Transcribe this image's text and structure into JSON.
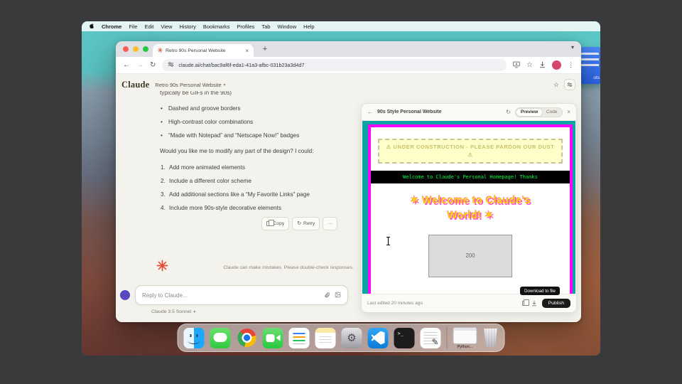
{
  "colors": {
    "claude_accent": "#d97757",
    "starburst_red": "#e2502f",
    "retro_magenta": "#ff00ff",
    "retro_teal": "#0aa3a6",
    "marquee_green": "#00ff41",
    "heading_gold": "#ffd400",
    "heading_pink": "#ff4fc0",
    "publish_dark": "#1b1a18",
    "browser_avatar_pink": "#d64570",
    "composer_avatar_purple": "#5849c0"
  },
  "icons": {
    "back": "←",
    "forward": "→",
    "reload": "↻",
    "new_tab": "+",
    "tab_close": "×",
    "tab_search_chevron": "▾",
    "star": "☆",
    "kebab_menu": "⋮",
    "chevron_down": "▾",
    "artifact_back": "←",
    "artifact_refresh": "↻",
    "artifact_close": "×",
    "retry": "↻",
    "more_options": "···",
    "gear": "⚙",
    "pencil": "✎",
    "terminal_prompt": ">_"
  },
  "menubar": {
    "app_name": "Chrome",
    "items": [
      "File",
      "Edit",
      "View",
      "History",
      "Bookmarks",
      "Profiles",
      "Tab",
      "Window",
      "Help"
    ]
  },
  "desktop": {
    "widget_label": "ots"
  },
  "browser": {
    "tab_title": "Retro 90s Personal Website",
    "url": "claude.ai/chat/bac9af6f-eda1-41a3-afbc-031b23a3d4d7"
  },
  "claude": {
    "logo_text": "Claude",
    "chat_title": "Retro 90s Personal Website",
    "message": {
      "clipped_line": "typically be GIFs in the 90s)",
      "bullets": [
        "Dashed and groove borders",
        "High-contrast color combinations",
        "“Made with Notepad” and “Netscape Now!” badges"
      ],
      "question": "Would you like me to modify any part of the design? I could:",
      "numbered_items": [
        "Add more animated elements",
        "Include a different color scheme",
        "Add additional sections like a “My Favorite Links” page",
        "Include more 90s-style decorative elements"
      ]
    },
    "actions": {
      "copy_label": "Copy",
      "retry_label": "Retry"
    },
    "disclaimer": "Claude can make mistakes. Please double-check responses.",
    "composer": {
      "placeholder": "Reply to Claude...",
      "model_name": "Claude 3.5 Sonnet"
    }
  },
  "artifact": {
    "title": "90s Style Personal Website",
    "preview_tab": "Preview",
    "code_tab": "Code",
    "site": {
      "construction_banner": "⚠ UNDER CONSTRUCTION - PLEASE PARDON OUR DUST ⚠",
      "marquee_text": "Welcome to Claude's Personal Homepage! Thanks",
      "heading": "✶ Welcome to Claude’s World! ✶",
      "image_placeholder_text": "200"
    },
    "download_tooltip": "Download to file",
    "last_edited": "Last edited 20 minutes ago",
    "publish_label": "Publish"
  },
  "dock": {
    "python_window_label": "Python..."
  }
}
